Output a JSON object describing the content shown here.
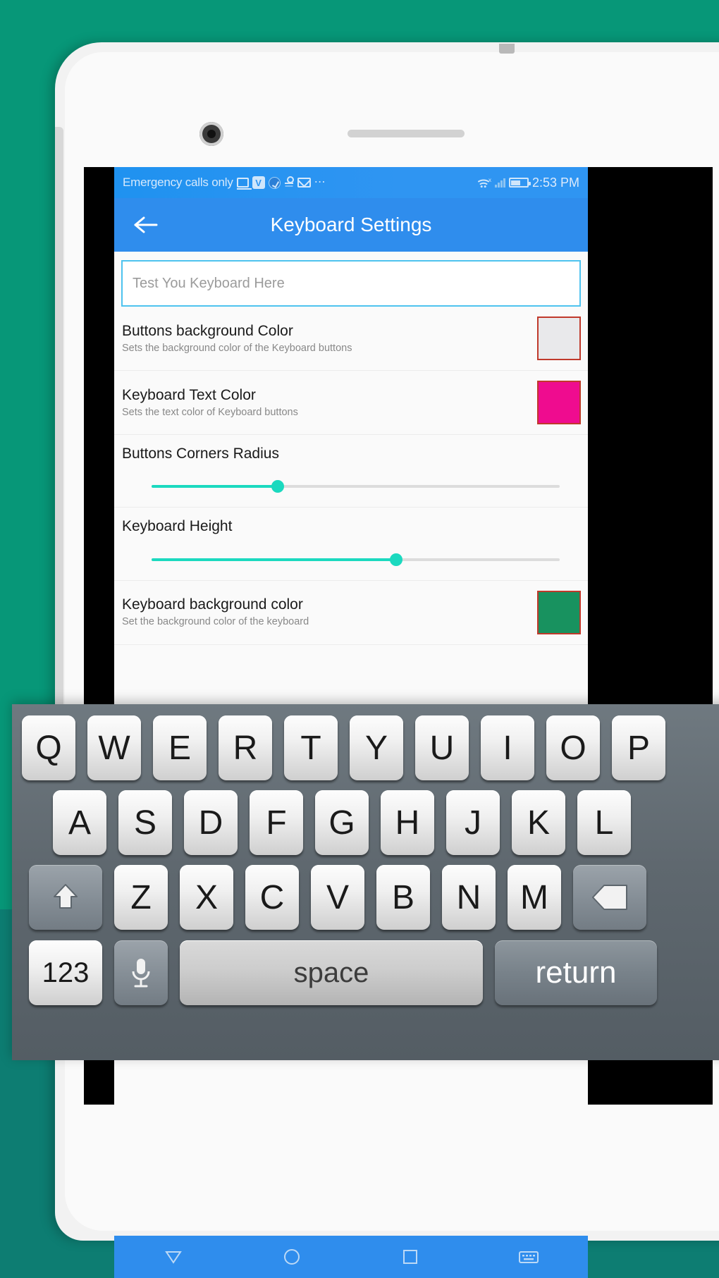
{
  "background": {
    "color": "#079778",
    "deep_color": "#0d7d72"
  },
  "statusbar": {
    "carrier": "Emergency calls only",
    "icons": [
      "monitor-icon",
      "vk-icon",
      "browser-icon",
      "odnoklassniki-icon",
      "mail-icon",
      "overflow-dots-icon"
    ],
    "vk_label": "V",
    "overflow": "⋯",
    "wifi": "wifi-icon",
    "signal": "signal-bars-icon",
    "battery": "battery-icon",
    "time": "2:53 PM"
  },
  "appbar": {
    "title": "Keyboard Settings",
    "back": "back-arrow-icon",
    "bg_color": "#2f8ded"
  },
  "test_input": {
    "placeholder": "Test You Keyboard Here",
    "value": "",
    "border_color": "#4ec3ef"
  },
  "settings": {
    "rows": [
      {
        "type": "color",
        "title": "Buttons background Color",
        "subtitle": "Sets the background color of the Keyboard buttons",
        "swatch_color": "#e9e9eb",
        "swatch_border": "#c0392b"
      },
      {
        "type": "color",
        "title": "Keyboard Text Color",
        "subtitle": "Sets the text color of Keyboard buttons",
        "swatch_color": "#ef0c8f",
        "swatch_border": "#c0392b"
      },
      {
        "type": "slider",
        "title": "Buttons Corners Radius",
        "subtitle": "",
        "value_percent": 31,
        "accent": "#1bd9bf"
      },
      {
        "type": "slider",
        "title": "Keyboard Height",
        "subtitle": "",
        "value_percent": 60,
        "accent": "#1bd9bf"
      },
      {
        "type": "color",
        "title": "Keyboard background color",
        "subtitle": "Set the background color of the keyboard",
        "swatch_color": "#18925f",
        "swatch_border": "#c0392b"
      }
    ]
  },
  "navbar": {
    "items": [
      "back-triangle-icon",
      "home-circle-icon",
      "recents-square-icon",
      "keyboard-icon"
    ]
  },
  "keyboard": {
    "row1": [
      "Q",
      "W",
      "E",
      "R",
      "T",
      "Y",
      "U",
      "I",
      "O",
      "P"
    ],
    "row2": [
      "A",
      "S",
      "D",
      "F",
      "G",
      "H",
      "J",
      "K",
      "L"
    ],
    "row3_shift": "shift-icon",
    "row3": [
      "Z",
      "X",
      "C",
      "V",
      "B",
      "N",
      "M"
    ],
    "row3_delete": "delete-icon",
    "numeric_label": "123",
    "mic_label": "microphone-icon",
    "space_label": "space",
    "return_label": "return"
  }
}
